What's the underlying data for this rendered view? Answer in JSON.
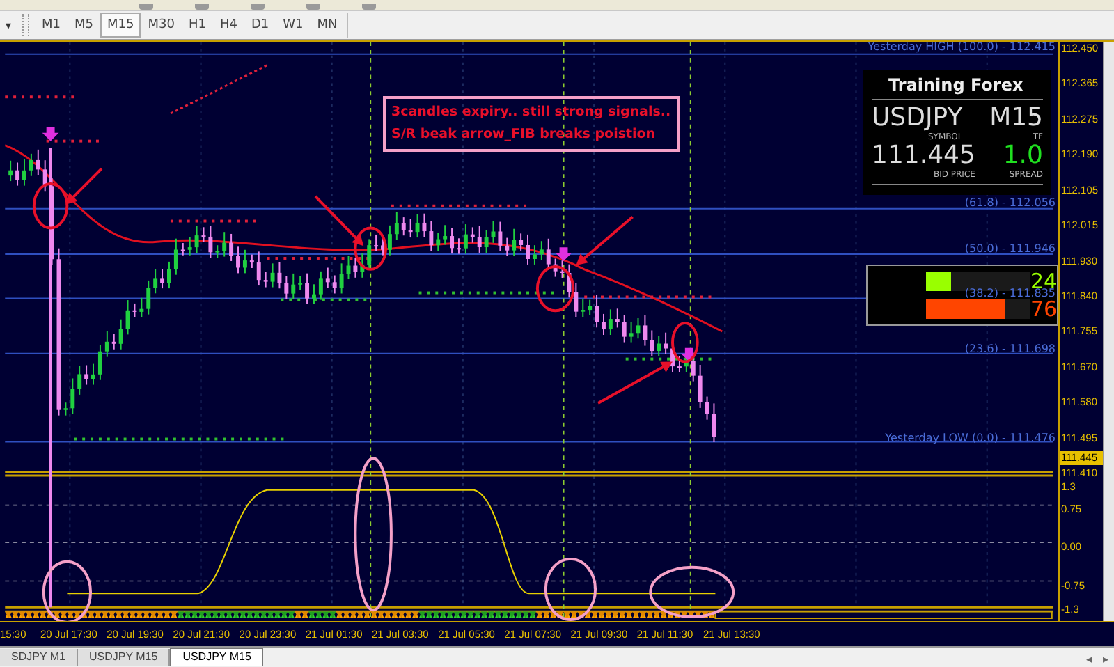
{
  "toolbar": {
    "dropdown": "▾",
    "timeframes": [
      {
        "label": "M1",
        "selected": false
      },
      {
        "label": "M5",
        "selected": false
      },
      {
        "label": "M15",
        "selected": true
      },
      {
        "label": "M30",
        "selected": false
      },
      {
        "label": "H1",
        "selected": false
      },
      {
        "label": "H4",
        "selected": false
      },
      {
        "label": "D1",
        "selected": false
      },
      {
        "label": "W1",
        "selected": false
      },
      {
        "label": "MN",
        "selected": false
      }
    ]
  },
  "chart": {
    "price_axis": [
      "112.450",
      "112.365",
      "112.275",
      "112.190",
      "112.105",
      "112.015",
      "111.930",
      "111.840",
      "111.755",
      "111.670",
      "111.580",
      "111.495",
      "111.410"
    ],
    "current_price": "111.445",
    "fib_levels": [
      "Yesterday HIGH (100.0) - 112.415",
      "(61.8) - 112.056",
      "(50.0) - 111.946",
      "(38.2) - 111.835",
      "(23.6) - 111.698",
      "Yesterday LOW (0.0) - 111.476"
    ],
    "annotation": [
      "3candles expiry.. still strong signals..",
      "S/R beak arrow_FIB breaks poistion"
    ],
    "info_panel": {
      "title": "Training Forex",
      "symbol": "USDJPY",
      "symbol_caption": "SYMBOL",
      "timeframe": "M15",
      "timeframe_caption": "TF",
      "bid": "111.445",
      "bid_caption": "BID PRICE",
      "spread": "1.0",
      "spread_caption": "SPREAD"
    },
    "strength_panel": {
      "bars": [
        {
          "value": "24",
          "level": 0.24,
          "color": "#99ff00"
        },
        {
          "value": "76",
          "level": 0.76,
          "color": "#ff4500"
        }
      ]
    }
  },
  "indicator": {
    "axis": [
      "1.3",
      "0.75",
      "0.00",
      "-0.75",
      "-1.3"
    ]
  },
  "time_axis": [
    "15:30",
    "20 Jul 17:30",
    "20 Jul 19:30",
    "20 Jul 21:30",
    "20 Jul 23:30",
    "21 Jul 01:30",
    "21 Jul 03:30",
    "21 Jul 05:30",
    "21 Jul 07:30",
    "21 Jul 09:30",
    "21 Jul 11:30",
    "21 Jul 13:30"
  ],
  "tabs": [
    {
      "label": "SDJPY M1",
      "selected": false
    },
    {
      "label": "USDJPY M15",
      "selected": false
    },
    {
      "label": "USDJPY M15",
      "selected": true
    }
  ],
  "tab_scroll": [
    "◂",
    "▸"
  ]
}
